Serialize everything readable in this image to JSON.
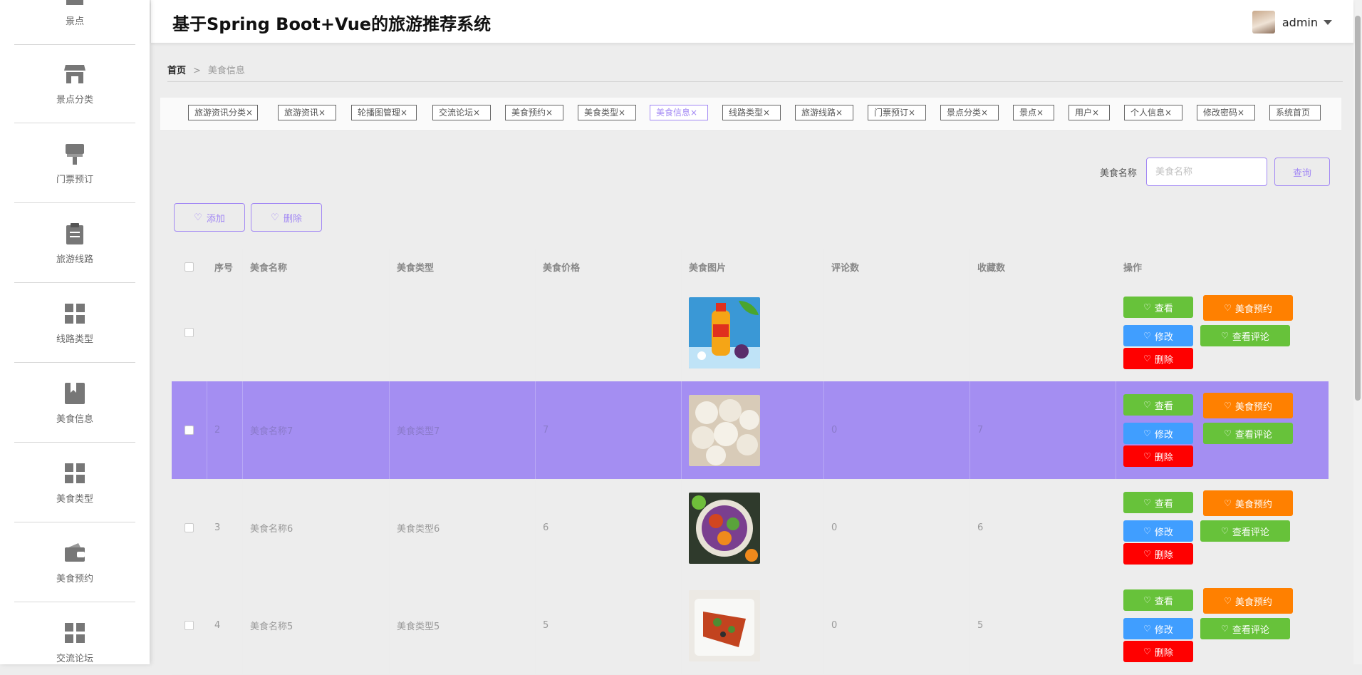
{
  "app": {
    "title": "基于Spring Boot+Vue的旅游推荐系统"
  },
  "user": {
    "name": "admin"
  },
  "sidebar": {
    "items": [
      {
        "label": "景点",
        "icon": "store-icon"
      },
      {
        "label": "景点分类",
        "icon": "store-icon"
      },
      {
        "label": "门票预订",
        "icon": "brush-icon"
      },
      {
        "label": "旅游线路",
        "icon": "clipboard-icon"
      },
      {
        "label": "线路类型",
        "icon": "grid-icon"
      },
      {
        "label": "美食信息",
        "icon": "book-icon"
      },
      {
        "label": "美食类型",
        "icon": "grid-icon"
      },
      {
        "label": "美食预约",
        "icon": "wallet-icon"
      },
      {
        "label": "交流论坛",
        "icon": "grid-icon"
      }
    ]
  },
  "breadcrumb": {
    "home": "首页",
    "separator": ">",
    "current": "美食信息"
  },
  "tags": [
    {
      "label": "旅游资讯分类×"
    },
    {
      "label": "旅游资讯×"
    },
    {
      "label": "轮播图管理×"
    },
    {
      "label": "交流论坛×"
    },
    {
      "label": "美食预约×"
    },
    {
      "label": "美食类型×"
    },
    {
      "label": "美食信息×",
      "active": true
    },
    {
      "label": "线路类型×"
    },
    {
      "label": "旅游线路×"
    },
    {
      "label": "门票预订×"
    },
    {
      "label": "景点分类×"
    },
    {
      "label": "景点×"
    },
    {
      "label": "用户×"
    },
    {
      "label": "个人信息×"
    },
    {
      "label": "修改密码×"
    },
    {
      "label": "系统首页"
    }
  ],
  "search": {
    "label": "美食名称",
    "placeholder": "美食名称",
    "button": "查询"
  },
  "toolbar": {
    "add_label": "添加",
    "delete_label": "删除"
  },
  "table": {
    "columns": [
      "序号",
      "美食名称",
      "美食类型",
      "美食价格",
      "美食图片",
      "评论数",
      "收藏数",
      "操作"
    ],
    "rows": [
      {
        "index": "",
        "name": "",
        "type": "",
        "price": "",
        "comments": "",
        "favorites": "",
        "image": "drink"
      },
      {
        "index": "2",
        "name": "美食名称7",
        "type": "美食类型7",
        "price": "7",
        "comments": "0",
        "favorites": "7",
        "image": "buns"
      },
      {
        "index": "3",
        "name": "美食名称6",
        "type": "美食类型6",
        "price": "6",
        "comments": "0",
        "favorites": "6",
        "image": "salad"
      },
      {
        "index": "4",
        "name": "美食名称5",
        "type": "美食类型5",
        "price": "5",
        "comments": "0",
        "favorites": "5",
        "image": "dish"
      }
    ],
    "actions": {
      "view": "查看",
      "reserve": "美食预约",
      "edit": "修改",
      "view_comments": "查看评论",
      "delete": "删除"
    }
  },
  "colors": {
    "accent": "#a389f4",
    "highlight_row": "#a48ef2",
    "green": "#67c23a",
    "orange": "#ff8000",
    "blue": "#409eff",
    "red": "#ff0000"
  }
}
